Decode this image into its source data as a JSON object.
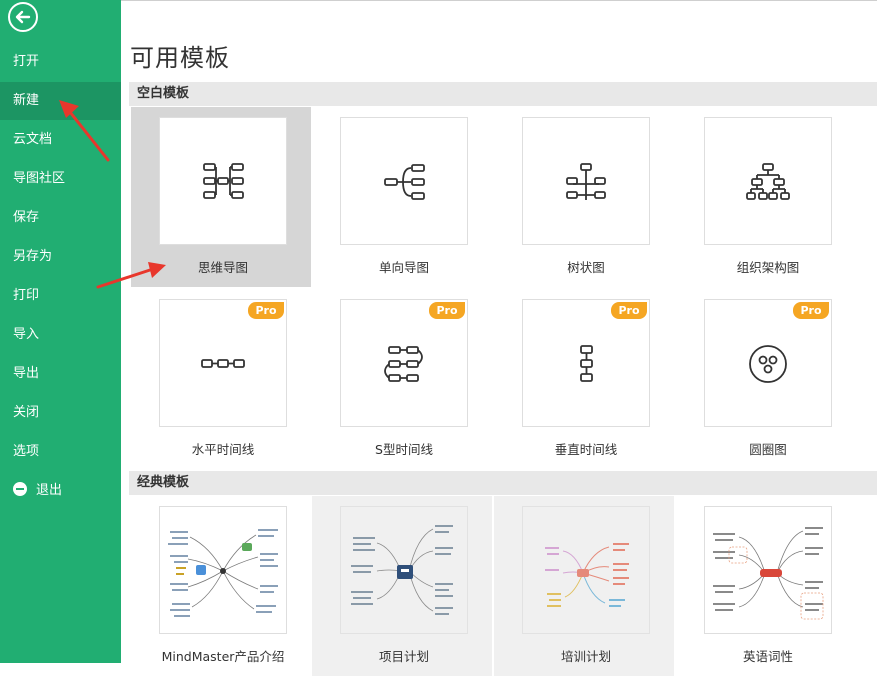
{
  "sidebar": {
    "items": [
      {
        "label": "打开"
      },
      {
        "label": "新建"
      },
      {
        "label": "云文档"
      },
      {
        "label": "导图社区"
      },
      {
        "label": "保存"
      },
      {
        "label": "另存为"
      },
      {
        "label": "打印"
      },
      {
        "label": "导入"
      },
      {
        "label": "导出"
      },
      {
        "label": "关闭"
      },
      {
        "label": "选项"
      },
      {
        "label": "退出"
      }
    ],
    "active_item": "新建"
  },
  "page": {
    "title": "可用模板"
  },
  "sections": [
    {
      "title": "空白模板",
      "templates": [
        {
          "label": "思维导图",
          "icon": "mind-map-icon",
          "pro": false,
          "selected": true
        },
        {
          "label": "单向导图",
          "icon": "right-map-icon",
          "pro": false
        },
        {
          "label": "树状图",
          "icon": "tree-map-icon",
          "pro": false
        },
        {
          "label": "组织架构图",
          "icon": "org-chart-icon",
          "pro": false
        },
        {
          "label": "水平时间线",
          "icon": "horizontal-timeline-icon",
          "pro": true
        },
        {
          "label": "S型时间线",
          "icon": "s-timeline-icon",
          "pro": true
        },
        {
          "label": "垂直时间线",
          "icon": "vertical-timeline-icon",
          "pro": true
        },
        {
          "label": "圆圈图",
          "icon": "circle-map-icon",
          "pro": true
        }
      ]
    },
    {
      "title": "经典模板",
      "templates": [
        {
          "label": "MindMaster产品介绍",
          "icon": "thumbnail-mindmaster-intro"
        },
        {
          "label": "项目计划",
          "icon": "thumbnail-project-plan"
        },
        {
          "label": "培训计划",
          "icon": "thumbnail-training-plan"
        },
        {
          "label": "英语词性",
          "icon": "thumbnail-english-pos"
        }
      ]
    }
  ],
  "badge": {
    "pro_label": "Pro"
  },
  "colors": {
    "sidebar": "#21ae72",
    "sidebar_active": "#1c9563",
    "pro_badge": "#f5a623",
    "annotation_arrow": "#e8372c"
  }
}
